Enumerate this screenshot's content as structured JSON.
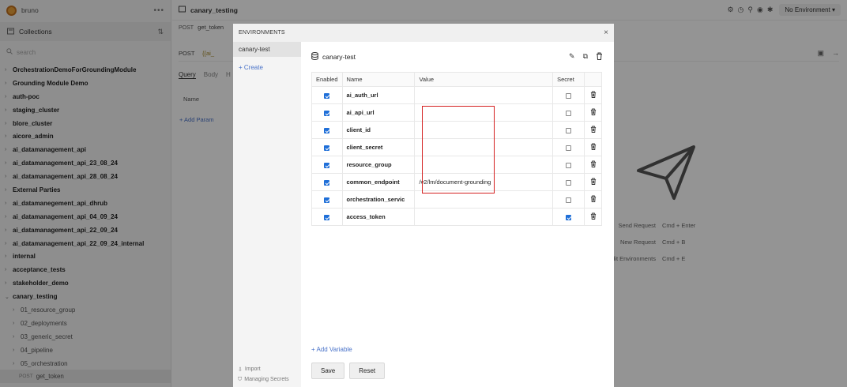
{
  "app": {
    "title": "bruno",
    "more_label": "•••"
  },
  "sidebar": {
    "collections_label": "Collections",
    "search_placeholder": "search",
    "collections": [
      "OrchestrationDemoForGroundingModule",
      "Grounding Module Demo",
      "auth-poc",
      "staging_cluster",
      "blore_cluster",
      "aicore_admin",
      "ai_datamanagement_api",
      "ai_datamanagement_api_23_08_24",
      "ai_datamanagement_api_28_08_24",
      "External Parties",
      "ai_datamanegement_api_dhrub",
      "ai_datamanagement_api_04_09_24",
      "ai_datamanagement_api_22_09_24",
      "ai_datamanagement_api_22_09_24_internal",
      "internal",
      "acceptance_tests",
      "stakeholder_demo",
      "canary_testing"
    ],
    "folders": [
      "01_resource_group",
      "02_deployments",
      "03_generic_secret",
      "04_pipeline",
      "05_orchestration"
    ],
    "request": {
      "method": "POST",
      "name": "get_token"
    }
  },
  "main": {
    "collection_title": "canary_testing",
    "environment_select": "No Environment",
    "tab": {
      "method": "POST",
      "name": "get_token"
    },
    "url_method": "POST",
    "url_value": "{{ai_",
    "pane_tabs": [
      "Query",
      "Body",
      "H"
    ],
    "param_header": "Name",
    "add_param": "+ Add Param",
    "shortcuts": [
      {
        "label": "Send Request",
        "keys": "Cmd + Enter"
      },
      {
        "label": "New Request",
        "keys": "Cmd + B"
      },
      {
        "label": "Edit Environments",
        "keys": "Cmd + E"
      }
    ]
  },
  "modal": {
    "title": "ENVIRONMENTS",
    "close": "×",
    "environments": [
      "canary-test"
    ],
    "create": "+ Create",
    "footer": {
      "import": "Import",
      "managing_secrets": "Managing Secrets"
    },
    "selected_env": "canary-test",
    "table_headers": {
      "enabled": "Enabled",
      "name": "Name",
      "value": "Value",
      "secret": "Secret"
    },
    "variables": [
      {
        "enabled": true,
        "name": "ai_auth_url",
        "value": "",
        "secret": false
      },
      {
        "enabled": true,
        "name": "ai_api_url",
        "value": "",
        "secret": false
      },
      {
        "enabled": true,
        "name": "client_id",
        "value": "",
        "secret": false
      },
      {
        "enabled": true,
        "name": "client_secret",
        "value": "",
        "secret": false
      },
      {
        "enabled": true,
        "name": "resource_group",
        "value": "",
        "secret": false
      },
      {
        "enabled": true,
        "name": "common_endpoint",
        "value": "/v2/lm/document-grounding",
        "secret": false
      },
      {
        "enabled": true,
        "name": "orchestration_servic",
        "value": "",
        "secret": false
      },
      {
        "enabled": true,
        "name": "access_token",
        "value": "",
        "secret": true
      }
    ],
    "add_variable": "+ Add Variable",
    "save": "Save",
    "reset": "Reset"
  },
  "colors": {
    "accent_link": "#4a73c9",
    "checkbox": "#1f6fd8",
    "highlight": "#d42020"
  }
}
